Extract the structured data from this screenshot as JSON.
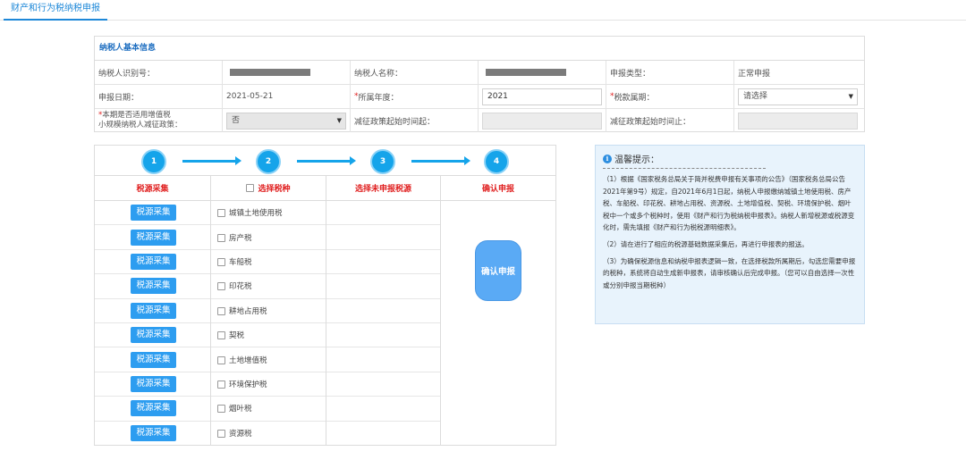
{
  "tab": {
    "label": "财产和行为税纳税申报"
  },
  "info": {
    "title": "纳税人基本信息",
    "rows": {
      "taxpayer_id_label": "纳税人识别号：",
      "taxpayer_name_label": "纳税人名称：",
      "declare_type_label": "申报类型：",
      "declare_type_value": "正常申报",
      "declare_date_label": "申报日期：",
      "declare_date_value": "2021-05-21",
      "year_label": "所属年度：",
      "year_value": "2021",
      "period_label": "税款属期：",
      "period_value": "请选择",
      "policy_label_line1": "本期是否适用增值税",
      "policy_label_line2": "小规模纳税人减征政策：",
      "policy_value": "否",
      "start_label": "减征政策起始时间起：",
      "end_label": "减征政策起始时间止："
    }
  },
  "steps": {
    "numbers": [
      "1",
      "2",
      "3",
      "4"
    ],
    "col_titles": [
      "税源采集",
      "选择税种",
      "选择未申报税源",
      "确认申报"
    ],
    "collect_button_label": "税源采集",
    "tax_items": [
      "城镇土地使用税",
      "房产税",
      "车船税",
      "印花税",
      "耕地占用税",
      "契税",
      "土地增值税",
      "环境保护税",
      "烟叶税",
      "资源税"
    ],
    "confirm_button_label": "确认申报"
  },
  "tips": {
    "title": "温馨提示：",
    "p1": "（1）根据《国家税务总局关于简并税费申报有关事项的公告》（国家税务总局公告2021年第9号）规定，自2021年6月1日起，纳税人申报缴纳城镇土地使用税、房产税、车船税、印花税、耕地占用税、资源税、土地增值税、契税、环境保护税、烟叶税中一个或多个税种时，使用《财产和行为税纳税申报表》。纳税人新增税源或税源变化时，需先填报《财产和行为税税源明细表》。",
    "p2": "（2）请在进行了相应的税源基础数据采集后，再进行申报表的报送。",
    "p3": "（3）为确保税源信息和纳税申报表逻辑一致，在选择税款所属期后，勾选您需要申报的税种，系统将自动生成新申报表，请审核确认后完成申报。（您可以自由选择一次性或分别申报当期税种）"
  }
}
